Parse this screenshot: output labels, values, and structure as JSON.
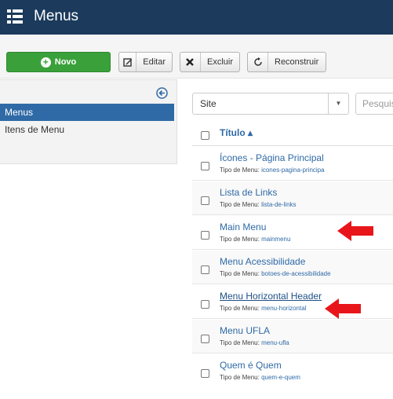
{
  "header": {
    "title": "Menus"
  },
  "toolbar": {
    "new_label": "Novo",
    "edit_label": "Editar",
    "delete_label": "Excluir",
    "rebuild_label": "Reconstruir"
  },
  "sidebar": {
    "items": [
      {
        "label": "Menus",
        "active": true
      },
      {
        "label": "Itens de Menu",
        "active": false
      }
    ]
  },
  "filters": {
    "site_value": "Site",
    "search_placeholder": "Pesquisa"
  },
  "table": {
    "column_title": "Título ▴",
    "type_prefix": "Tipo de Menu:",
    "rows": [
      {
        "name": "Ícones - Página Principal",
        "type": "icones-pagina-principa"
      },
      {
        "name": "Lista de Links",
        "type": "lista-de-links"
      },
      {
        "name": "Main Menu",
        "type": "mainmenu"
      },
      {
        "name": "Menu Acessibilidade",
        "type": "botoes-de-acessibilidade"
      },
      {
        "name": "Menu Horizontal Header",
        "type": "menu-horizontal"
      },
      {
        "name": "Menu UFLA",
        "type": "menu-ufla"
      },
      {
        "name": "Quem é Quem",
        "type": "quem-e-quem"
      }
    ]
  },
  "colors": {
    "header_bg": "#1b3a5c",
    "accent_blue": "#2f6aa6",
    "new_button_green": "#3aa13a",
    "arrow_red": "#e8161b"
  }
}
